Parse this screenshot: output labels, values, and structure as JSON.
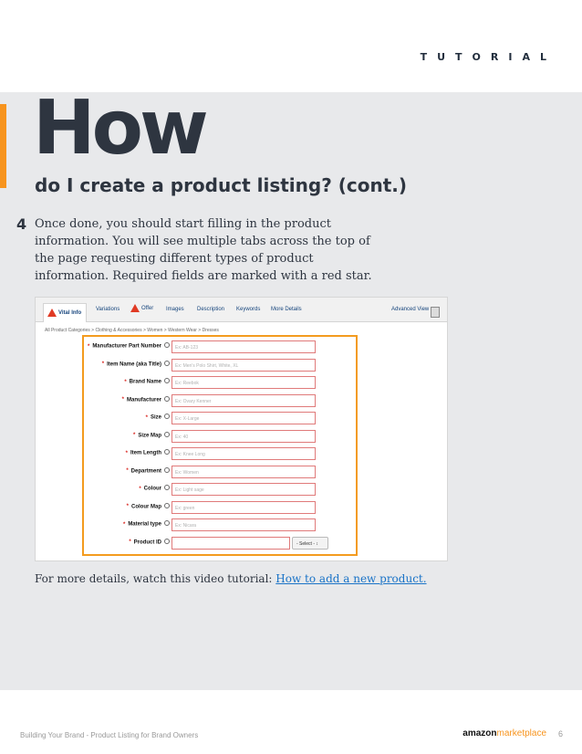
{
  "header": {
    "label": "TUTORIAL"
  },
  "title": {
    "big": "How",
    "subtitle": "do I create a product listing? (cont.)"
  },
  "step": {
    "number": "4",
    "text": "Once done, you should start filling in the product information. You will see multiple tabs across the top of the page requesting different types of product information. Required fields are marked with a red star."
  },
  "screenshot": {
    "tabs": [
      "Vital Info",
      "Variations",
      "Offer",
      "Images",
      "Description",
      "Keywords",
      "More Details"
    ],
    "advanced_view": "Advanced View",
    "breadcrumb": "All Product Categories > Clothing & Accessories > Women > Western Wear > Dresses",
    "fields": [
      {
        "label": "Manufacturer Part Number",
        "placeholder": "Ex: AB-123"
      },
      {
        "label": "Item Name (aka Title)",
        "placeholder": "Ex: Men's Polo Shirt, White, XL"
      },
      {
        "label": "Brand Name",
        "placeholder": "Ex: Reebok"
      },
      {
        "label": "Manufacturer",
        "placeholder": "Ex: Ovary Kenner"
      },
      {
        "label": "Size",
        "placeholder": "Ex: X-Large"
      },
      {
        "label": "Size Map",
        "placeholder": "Ex: 40"
      },
      {
        "label": "Item Length",
        "placeholder": "Ex: Knee Long"
      },
      {
        "label": "Department",
        "placeholder": "Ex: Women"
      },
      {
        "label": "Colour",
        "placeholder": "Ex: Light sage"
      },
      {
        "label": "Colour Map",
        "placeholder": "Ex: green"
      },
      {
        "label": "Material type",
        "placeholder": "Ex: Nicara"
      },
      {
        "label": "Product ID",
        "placeholder": "",
        "select": "- Select -"
      }
    ]
  },
  "more": {
    "prefix": "For more details, watch this video tutorial:",
    "link": "How to add a new product."
  },
  "footer": {
    "left": "Building Your Brand - Product Listing for Brand Owners",
    "logo_bold": "amazon",
    "logo_light": "marketplace",
    "page": "6"
  },
  "colors": {
    "accent": "#f7941e",
    "dark": "#2e3540",
    "link": "#1a73c7",
    "required": "#d9221c"
  }
}
